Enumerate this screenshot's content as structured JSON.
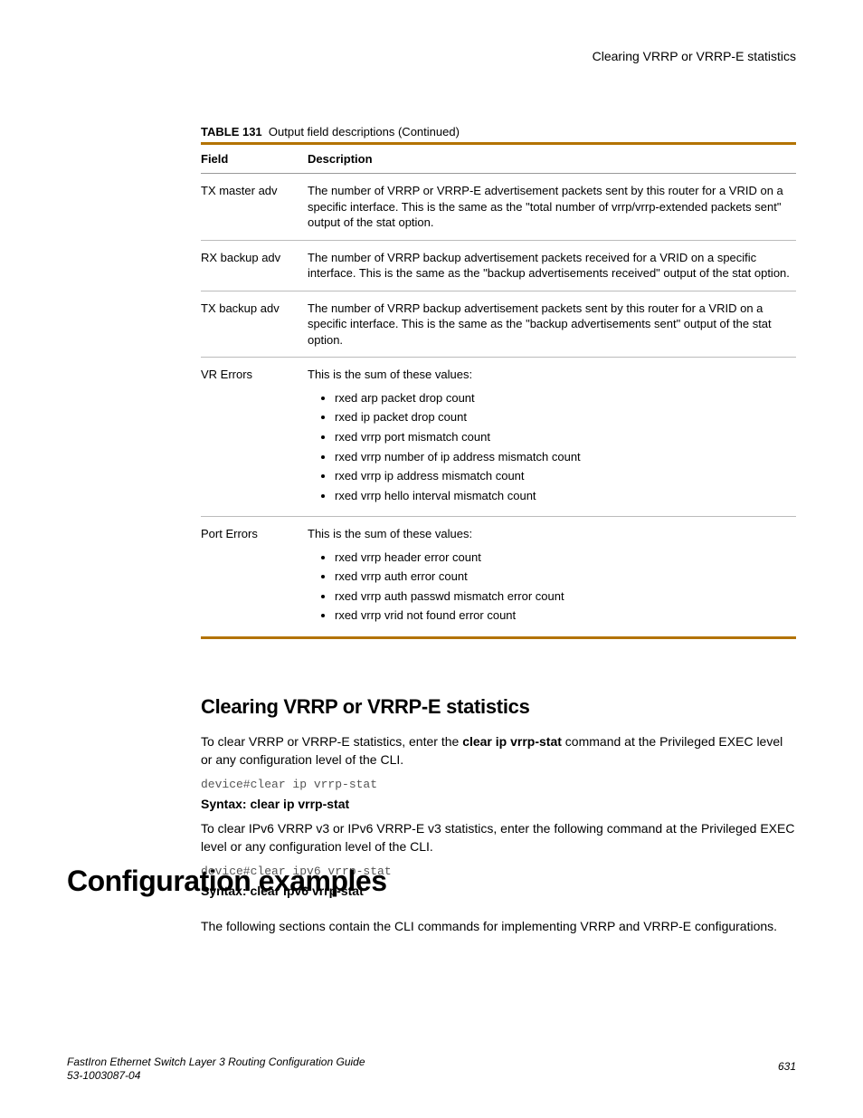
{
  "header": {
    "right": "Clearing VRRP or VRRP-E statistics"
  },
  "table": {
    "label": "TABLE 131",
    "caption": "Output field descriptions (Continued)",
    "col_field": "Field",
    "col_desc": "Description",
    "rows": [
      {
        "field": "TX master adv",
        "desc": "The number of VRRP or VRRP-E advertisement packets sent by this router for a VRID on a specific interface. This is the same as the \"total number of vrrp/vrrp-extended packets sent\" output of the stat option."
      },
      {
        "field": "RX backup adv",
        "desc": "The number of VRRP backup advertisement packets received for a VRID on a specific interface. This is the same as the \"backup advertisements received\" output of the stat option."
      },
      {
        "field": "TX backup adv",
        "desc": "The number of VRRP backup advertisement packets sent by this router for a VRID on a specific interface. This is the same as the \"backup advertisements sent\" output of the stat option."
      },
      {
        "field": "VR Errors",
        "intro": "This is the sum of these values:",
        "items": [
          "rxed arp packet drop count",
          "rxed ip packet drop count",
          "rxed vrrp port mismatch count",
          "rxed vrrp number of ip address mismatch count",
          "rxed vrrp ip address mismatch count",
          "rxed vrrp hello interval mismatch count"
        ]
      },
      {
        "field": "Port Errors",
        "intro": "This is the sum of these values:",
        "items": [
          "rxed vrrp header error count",
          "rxed vrrp auth error count",
          "rxed vrrp auth passwd mismatch error count",
          "rxed vrrp vrid not found error count"
        ]
      }
    ]
  },
  "section1": {
    "title": "Clearing VRRP or VRRP-E statistics",
    "p1a": "To clear VRRP or VRRP-E statistics, enter the ",
    "p1b": "clear ip vrrp-stat",
    "p1c": " command at the Privileged EXEC level or any configuration level of the CLI.",
    "code1": "device#clear ip vrrp-stat",
    "syntax1": "Syntax: clear ip vrrp-stat",
    "p2": "To clear IPv6 VRRP v3 or IPv6 VRRP-E v3 statistics, enter the following command at the Privileged EXEC level or any configuration level of the CLI.",
    "code2": "device#clear ipv6 vrrp-stat",
    "syntax2": "Syntax: clear ipv6 vrrp-stat"
  },
  "section2": {
    "title": "Configuration examples",
    "p1": "The following sections contain the CLI commands for implementing VRRP and VRRP-E configurations."
  },
  "footer": {
    "title": "FastIron Ethernet Switch Layer 3 Routing Configuration Guide",
    "docnum": "53-1003087-04",
    "page": "631"
  }
}
